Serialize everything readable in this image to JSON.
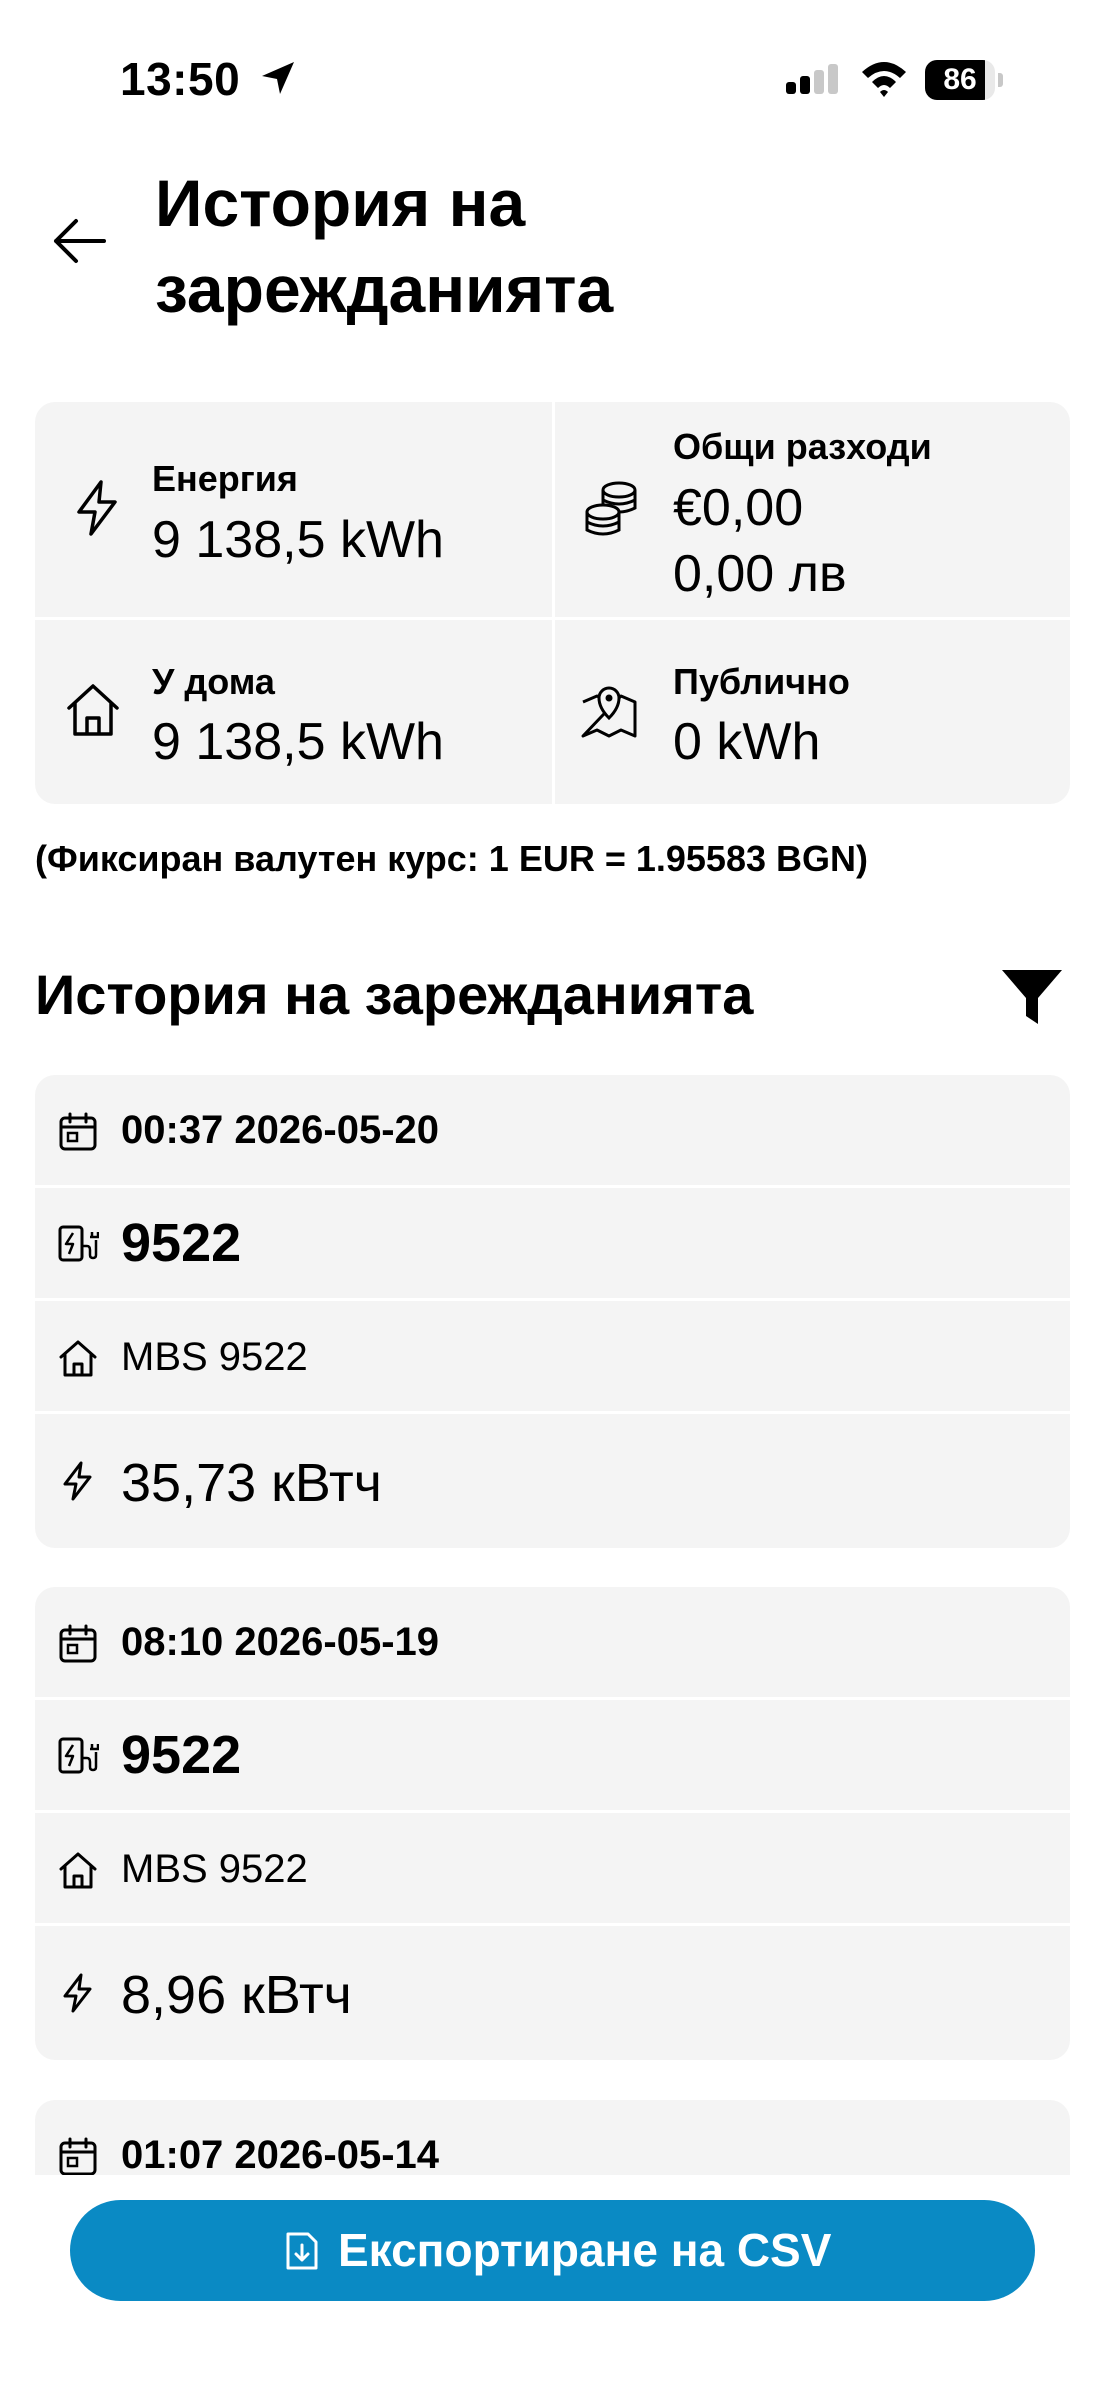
{
  "status_bar": {
    "time": "13:50",
    "battery": "86",
    "battery_level": 0.86,
    "icons": [
      "location-arrow-icon",
      "cellular-signal-icon",
      "wifi-icon",
      "battery-icon"
    ]
  },
  "header": {
    "title": "История на зарежданията",
    "back_icon": "arrow-left-icon"
  },
  "summary": {
    "energy": {
      "label": "Енергия",
      "value": "9 138,5 kWh",
      "icon": "lightning-icon"
    },
    "costs": {
      "label": "Общи разходи",
      "value_eur": "€0,00",
      "value_bgn": "0,00 лв",
      "icon": "coins-icon"
    },
    "home": {
      "label": "У дома",
      "value": "9 138,5 kWh",
      "icon": "house-icon"
    },
    "public": {
      "label": "Публично",
      "value": "0 kWh",
      "icon": "map-pin-icon"
    }
  },
  "exchange_rate_note": "(Фиксиран валутен курс: 1 EUR = 1.95583 BGN)",
  "history": {
    "title": "История на зарежданията",
    "filter_icon": "filter-icon",
    "sessions": [
      {
        "datetime": "00:37 2026-05-20",
        "charger": "9522",
        "location": "MBS 9522",
        "energy": "35,73 кВтч"
      },
      {
        "datetime": "08:10 2026-05-19",
        "charger": "9522",
        "location": "MBS 9522",
        "energy": "8,96 кВтч"
      },
      {
        "datetime": "01:07 2026-05-14"
      }
    ]
  },
  "export_button": {
    "label": "Експортиране на CSV",
    "icon": "file-download-icon"
  },
  "colors": {
    "accent": "#0a8ac4",
    "card_bg": "#f4f4f4"
  }
}
